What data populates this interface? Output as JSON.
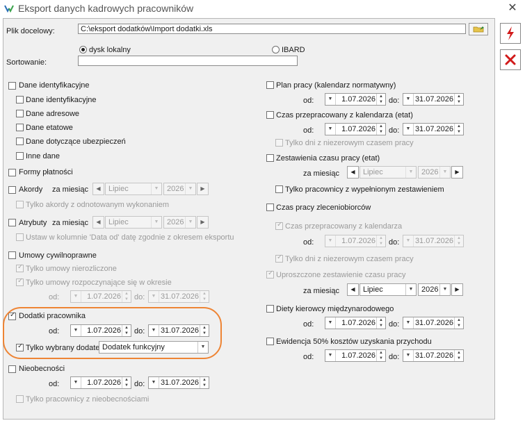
{
  "window": {
    "title": "Eksport danych kadrowych pracowników",
    "close_label": "✕"
  },
  "colors": {
    "highlight": "#ee8434",
    "accent_red": "#d11a1a"
  },
  "file": {
    "label": "Plik docelowy:",
    "value": "C:\\eksport dodatków\\Import dodatki.xls"
  },
  "radio": {
    "local": "dysk lokalny",
    "ibard": "IBARD"
  },
  "sort": {
    "label": "Sortowanie:",
    "value": ""
  },
  "left": {
    "dane_identyfikacyjne": "Dane identyfikacyjne",
    "sub_identyfikacyjne": "Dane identyfikacyjne",
    "sub_adresowe": "Dane adresowe",
    "sub_etatowe": "Dane etatowe",
    "sub_ubezpieczen": "Dane dotyczące ubezpieczeń",
    "sub_inne": "Inne dane",
    "formy": "Formy płatności",
    "akordy": "Akordy",
    "za_miesiac": "za miesiąc",
    "akordy_month": "Lipiec",
    "akordy_year": "2026",
    "akordy_only": "Tylko akordy z odnotowanym wykonaniem",
    "atrybuty": "Atrybuty",
    "atrybuty_month": "Lipiec",
    "atrybuty_year": "2026",
    "atrybuty_ustaw": "Ustaw w kolumnie 'Data od' datę zgodnie z okresem eksportu",
    "umowy": "Umowy cywilnoprawne",
    "umowy_nierozliczone": "Tylko umowy nierozliczone",
    "umowy_rozpoczynajace": "Tylko umowy rozpoczynające się w okresie",
    "od": "od:",
    "do": "do:",
    "umowy_from": "1.07.2026",
    "umowy_to": "31.07.2026",
    "dodatki": "Dodatki pracownika",
    "dodatki_from": "1.07.2026",
    "dodatki_to": "31.07.2026",
    "tylko_dodatek": "Tylko wybrany dodatek",
    "dodatek_value": "Dodatek funkcyjny",
    "nieobecnosci": "Nieobecności",
    "nieob_from": "1.07.2026",
    "nieob_to": "31.07.2026",
    "nieob_only": "Tylko pracownicy z nieobecnościami"
  },
  "right": {
    "plan": "Plan pracy (kalendarz normatywny)",
    "od": "od:",
    "do": "do:",
    "plan_from": "1.07.2026",
    "plan_to": "31.07.2026",
    "czas_kal": "Czas przepracowany z kalendarza (etat)",
    "czas_kal_from": "1.07.2026",
    "czas_kal_to": "31.07.2026",
    "czas_kal_only": "Tylko dni z niezerowym czasem pracy",
    "zestawienia": "Zestawienia czasu pracy (etat)",
    "za_miesiac": "za miesiąc",
    "zest_month": "Lipiec",
    "zest_year": "2026",
    "zest_only": "Tylko pracownicy z wypełnionym zestawieniem",
    "zlecenio": "Czas pracy zleceniobiorców",
    "zlec_kal": "Czas przepracowany z kalendarza",
    "zlec_from": "1.07.2026",
    "zlec_to": "31.07.2026",
    "zlec_only": "Tylko dni z niezerowym czasem pracy",
    "uproszczone": "Uproszczone zestawienie czasu pracy",
    "upr_month": "Lipiec",
    "upr_year": "2026",
    "diety": "Diety kierowcy międzynarodowego",
    "diety_from": "1.07.2026",
    "diety_to": "31.07.2026",
    "ewidencja": "Ewidencja 50% kosztów uzyskania przychodu",
    "ewid_from": "1.07.2026",
    "ewid_to": "31.07.2026"
  }
}
